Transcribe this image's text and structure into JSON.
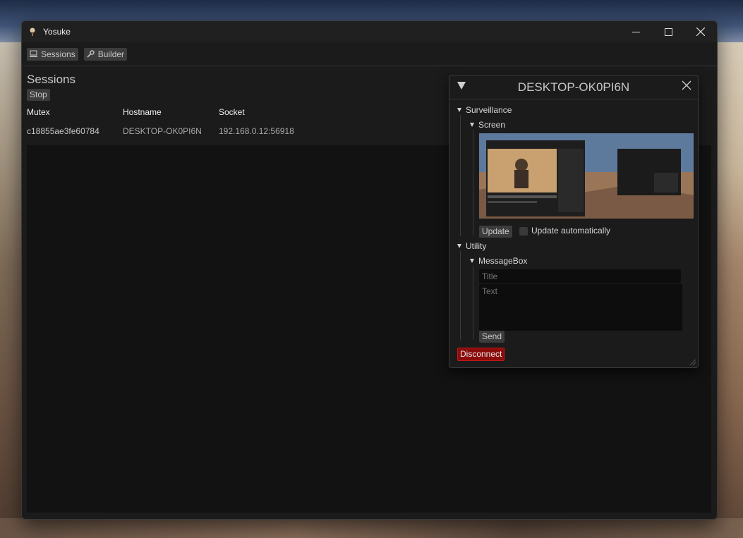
{
  "window": {
    "title": "Yosuke",
    "controls": {
      "minimize": "—",
      "maximize": "☐",
      "close": "✕"
    }
  },
  "toolbar": {
    "sessions_label": "Sessions",
    "builder_label": "Builder"
  },
  "sessions": {
    "heading": "Sessions",
    "stop_label": "Stop",
    "columns": [
      "Mutex",
      "Hostname",
      "Socket"
    ],
    "rows": [
      {
        "mutex": "c18855ae3fe60784",
        "hostname": "DESKTOP-OK0PI6N",
        "socket": "192.168.0.12:56918"
      }
    ]
  },
  "panel": {
    "title": "DESKTOP-OK0PI6N",
    "surveillance": {
      "label": "Surveillance",
      "screen": {
        "label": "Screen",
        "update_label": "Update",
        "auto_label": "Update automatically",
        "auto_checked": false
      }
    },
    "utility": {
      "label": "Utility",
      "messagebox": {
        "label": "MessageBox",
        "title_placeholder": "Title",
        "text_placeholder": "Text",
        "send_label": "Send"
      }
    },
    "disconnect_label": "Disconnect"
  },
  "colors": {
    "background": "#1b1b1b",
    "table_bg": "#121212",
    "danger": "#8c0b0b"
  }
}
